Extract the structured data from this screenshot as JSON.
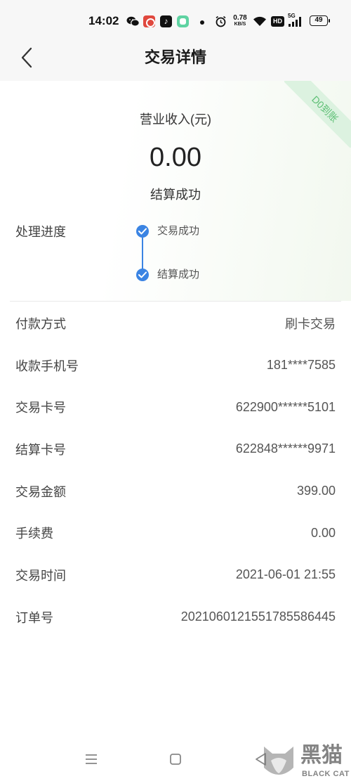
{
  "status_bar": {
    "time": "14:02",
    "notification_icons": [
      "wechat-icon",
      "red-app-icon",
      "tiktok-icon",
      "green-app-icon"
    ],
    "net_speed_value": "0.78",
    "net_speed_unit": "KB/S",
    "hd_badge": "HD",
    "network_type": "5G",
    "battery_level": "49",
    "system_icons": [
      "alarm-icon",
      "wifi-icon",
      "signal-icon",
      "battery-icon"
    ]
  },
  "header": {
    "back_icon": "chevron-left-icon",
    "title": "交易详情"
  },
  "summary": {
    "ribbon": "D0到账",
    "income_label": "营业收入(元)",
    "amount": "0.00",
    "status": "结算成功"
  },
  "progress": {
    "label": "处理进度",
    "steps": [
      {
        "label": "交易成功",
        "icon": "check-circle-icon"
      },
      {
        "label": "结算成功",
        "icon": "check-circle-icon"
      }
    ]
  },
  "details": [
    {
      "label": "付款方式",
      "value": "刷卡交易"
    },
    {
      "label": "收款手机号",
      "value": "181****7585"
    },
    {
      "label": "交易卡号",
      "value": "622900******5101"
    },
    {
      "label": "结算卡号",
      "value": "622848******9971"
    },
    {
      "label": "交易金额",
      "value": "399.00"
    },
    {
      "label": "手续费",
      "value": "0.00"
    },
    {
      "label": "交易时间",
      "value": "2021-06-01 21:55"
    },
    {
      "label": "订单号",
      "value": "2021060121551785586445"
    }
  ],
  "nav_bar": {
    "icons": [
      "menu-icon",
      "home-square-icon",
      "back-triangle-icon"
    ]
  },
  "watermark": {
    "text_cn": "黑猫",
    "text_en": "BLACK CAT"
  },
  "colors": {
    "accent_blue": "#3b84e3",
    "ribbon_green": "#5cbf74",
    "ribbon_bg": "#dcf2e0",
    "label_text": "#444444",
    "value_text": "#555555"
  }
}
